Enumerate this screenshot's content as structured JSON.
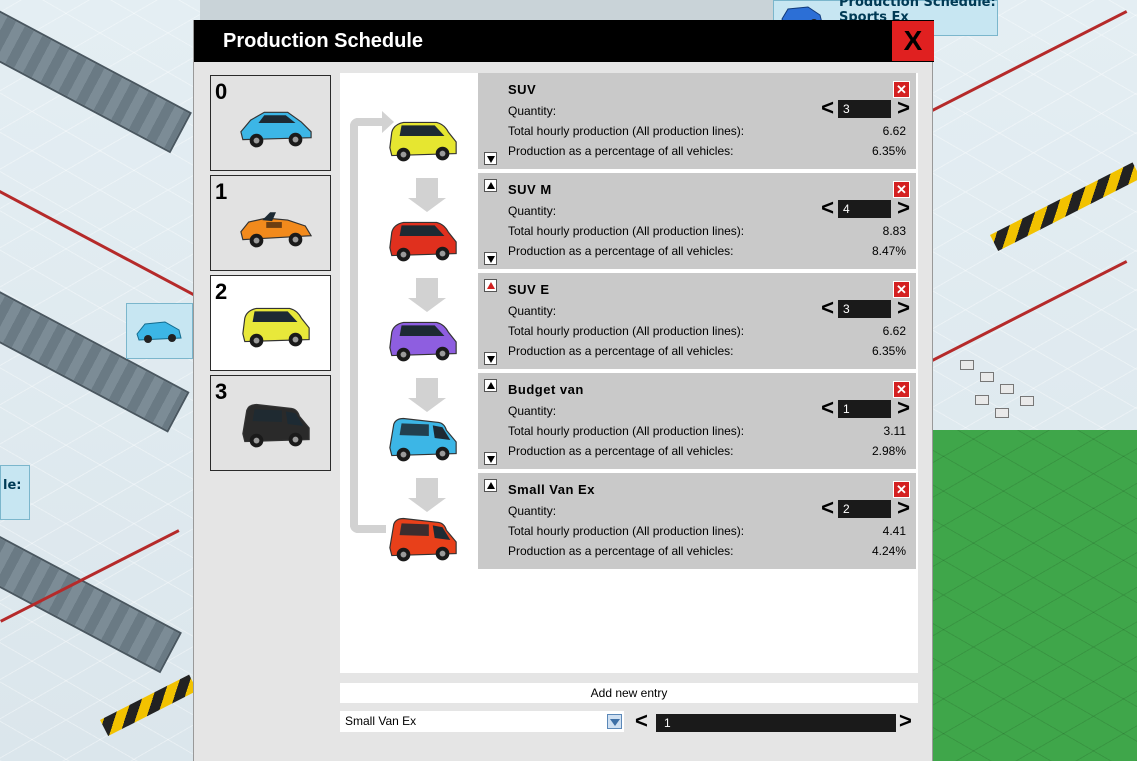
{
  "dialog": {
    "title": "Production Schedule",
    "close_label": "X"
  },
  "background_tags": {
    "top_right_line1": "Production Schedule:",
    "top_right_line2": "Sports Ex",
    "left_partial": "le:"
  },
  "slots": [
    {
      "number": "0",
      "color": "#3cb6e6",
      "icon": "sedan-car-icon"
    },
    {
      "number": "1",
      "color": "#f28a1c",
      "icon": "convertible-car-icon"
    },
    {
      "number": "2",
      "color": "#e8e83a",
      "icon": "suv-car-icon",
      "selected": true
    },
    {
      "number": "3",
      "color": "#2a2a2a",
      "icon": "van-car-icon"
    }
  ],
  "labels": {
    "quantity": "Quantity:",
    "hourly": "Total hourly production (All production lines):",
    "percentage": "Production as a percentage of all vehicles:",
    "qty_decrease": "<",
    "qty_increase": ">",
    "remove": "✕"
  },
  "entries": [
    {
      "name": "SUV",
      "quantity": "3",
      "hourly": "6.62",
      "percentage": "6.35%",
      "color": "#e6e630",
      "icon": "suv-car-icon",
      "move_up": false,
      "move_down": true
    },
    {
      "name": "SUV M",
      "quantity": "4",
      "hourly": "8.83",
      "percentage": "8.47%",
      "color": "#e0301e",
      "icon": "suv-car-icon",
      "move_up": true,
      "move_down": true
    },
    {
      "name": "SUV E",
      "quantity": "3",
      "hourly": "6.62",
      "percentage": "6.35%",
      "color": "#8e5ee0",
      "icon": "suv-car-icon",
      "move_up": true,
      "move_up_red": true,
      "move_down": true
    },
    {
      "name": "Budget van",
      "quantity": "1",
      "hourly": "3.11",
      "percentage": "2.98%",
      "color": "#3cb6e6",
      "icon": "van-car-icon",
      "move_up": true,
      "move_down": true
    },
    {
      "name": "Small Van Ex",
      "quantity": "2",
      "hourly": "4.41",
      "percentage": "4.24%",
      "color": "#e8401a",
      "icon": "van-car-icon",
      "move_up": true,
      "move_down": false
    }
  ],
  "add_entry": {
    "label": "Add new entry",
    "selected_model": "Small Van Ex",
    "quantity": "1",
    "decrease": "<",
    "increase": ">"
  }
}
